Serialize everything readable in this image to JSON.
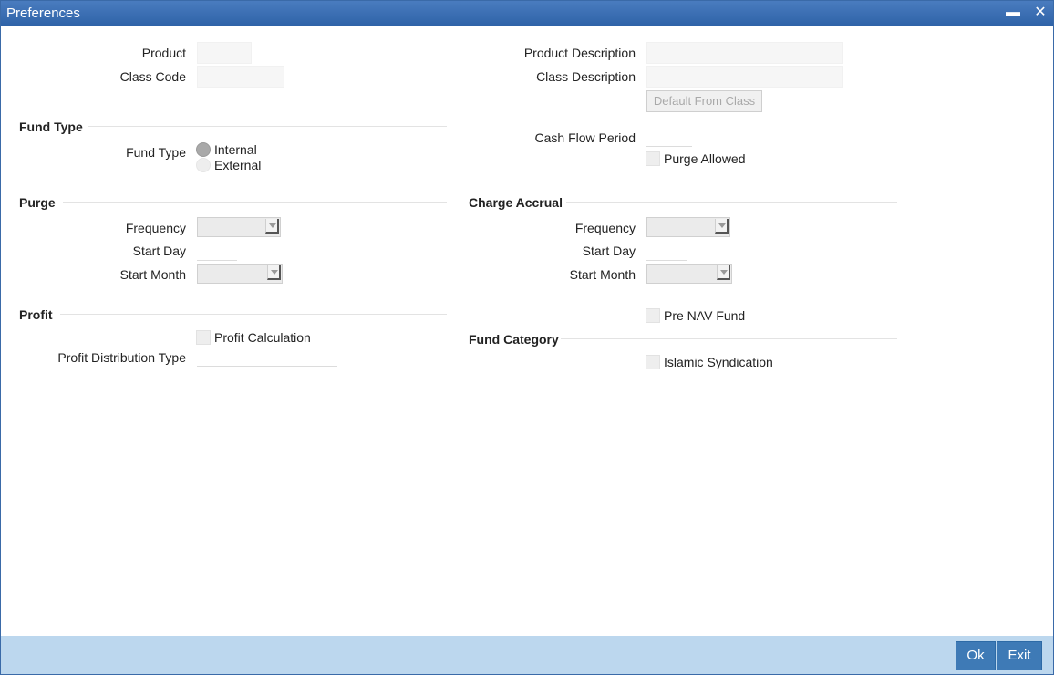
{
  "window": {
    "title": "Preferences"
  },
  "title_controls": {
    "minimize": "▬",
    "close": "✕"
  },
  "fields": {
    "product": "Product",
    "class_code": "Class Code",
    "product_description": "Product Description",
    "class_description": "Class Description",
    "default_from_class": "Default From Class"
  },
  "fund_type": {
    "section": "Fund Type",
    "label": "Fund Type",
    "options": [
      "Internal",
      "External"
    ],
    "selected": "Internal"
  },
  "cash_flow_period": "Cash Flow Period",
  "purge_allowed": "Purge Allowed",
  "purge": {
    "section": "Purge",
    "frequency": "Frequency",
    "start_day": "Start Day",
    "start_month": "Start Month"
  },
  "charge_accrual": {
    "section": "Charge Accrual",
    "frequency": "Frequency",
    "start_day": "Start Day",
    "start_month": "Start Month"
  },
  "profit": {
    "section": "Profit",
    "profit_calculation": "Profit Calculation",
    "profit_distribution_type": "Profit Distribution Type"
  },
  "pre_nav_fund": "Pre NAV Fund",
  "fund_category": {
    "section": "Fund Category",
    "islamic_syndication": "Islamic Syndication"
  },
  "footer": {
    "ok": "Ok",
    "exit": "Exit"
  },
  "colors": {
    "titlebar": "#2f63a8",
    "footer": "#bcd7ee",
    "button": "#3e7ab6"
  }
}
